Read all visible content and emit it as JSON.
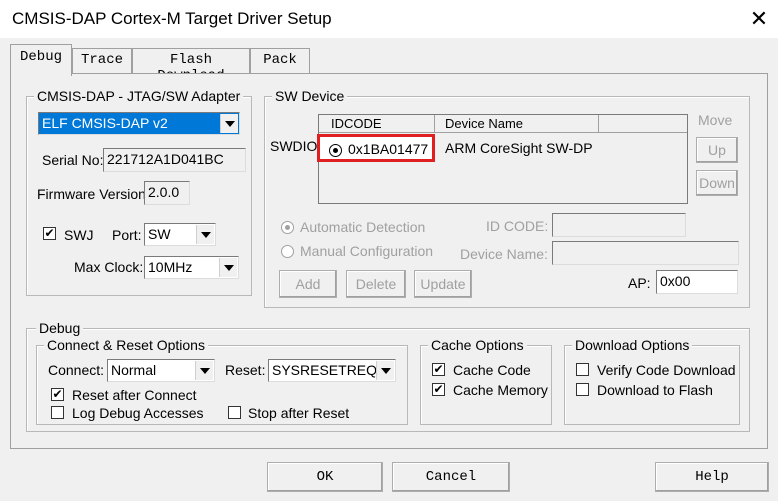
{
  "window": {
    "title": "CMSIS-DAP Cortex-M Target Driver Setup",
    "close_glyph": "✕"
  },
  "tabs": [
    "Debug",
    "Trace",
    "Flash Download",
    "Pack"
  ],
  "adapter": {
    "group_label": "CMSIS-DAP - JTAG/SW Adapter",
    "device_value": "ELF CMSIS-DAP v2",
    "serial_label": "Serial No:",
    "serial_value": "221712A1D041BC",
    "firmware_label": "Firmware Version:",
    "firmware_value": "2.0.0",
    "swj_label": "SWJ",
    "swj_checked": true,
    "port_label": "Port:",
    "port_value": "SW",
    "clock_label": "Max Clock:",
    "clock_value": "10MHz"
  },
  "sw_device": {
    "group_label": "SW Device",
    "row_label": "SWDIO",
    "col_idcode": "IDCODE",
    "col_device": "Device Name",
    "row_idcode": "0x1BA01477",
    "row_device": "ARM CoreSight SW-DP",
    "highlight_color": "#e02020",
    "move_label": "Move",
    "up_label": "Up",
    "down_label": "Down",
    "auto_label": "Automatic Detection",
    "manual_label": "Manual Configuration",
    "idcode_label": "ID CODE:",
    "devname_label": "Device Name:",
    "add_label": "Add",
    "delete_label": "Delete",
    "update_label": "Update",
    "ap_label": "AP:",
    "ap_value": "0x00"
  },
  "debug": {
    "group_label": "Debug",
    "connect_group": "Connect & Reset Options",
    "connect_label": "Connect:",
    "connect_value": "Normal",
    "reset_label": "Reset:",
    "reset_value": "SYSRESETREQ",
    "reset_after_connect": "Reset after Connect",
    "log_debug": "Log Debug Accesses",
    "stop_after_reset": "Stop after Reset",
    "cache_group": "Cache Options",
    "cache_code": "Cache Code",
    "cache_memory": "Cache Memory",
    "download_group": "Download Options",
    "verify_code": "Verify Code Download",
    "download_flash": "Download to Flash"
  },
  "buttons": {
    "ok": "OK",
    "cancel": "Cancel",
    "help": "Help"
  }
}
